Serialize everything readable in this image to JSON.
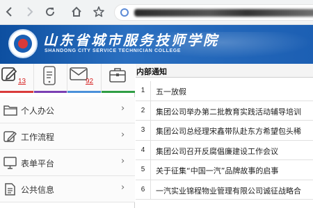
{
  "browser": {
    "icons": [
      "back-arrow-icon",
      "forward-arrow-icon",
      "reload-icon",
      "home-icon",
      "bookmark-star-icon",
      "site-info-icon"
    ]
  },
  "banner": {
    "school_name": "山东省城市服务技师学院",
    "school_name_en": "SHANDONG CITY SERVICE TECHNICIAN COLLEGE"
  },
  "quick_icons": [
    {
      "icon": "edit-icon",
      "count": "13",
      "bar_color": "#d93a3a"
    },
    {
      "icon": "phone-document-icon",
      "count": "",
      "bar_color": "#7b3fb3"
    },
    {
      "icon": "mail-icon",
      "count": "92",
      "bar_color": "#4a90d9"
    },
    {
      "icon": "briefcase-icon",
      "count": "",
      "bar_color": "#2f9e44"
    }
  ],
  "menu": [
    {
      "label": "个人办公",
      "icon": "folder-icon"
    },
    {
      "label": "工作流程",
      "icon": "edit-icon"
    },
    {
      "label": "表单平台",
      "icon": "monitor-icon"
    },
    {
      "label": "公共信息",
      "icon": "document-icon"
    }
  ],
  "notices": {
    "header": "内部通知",
    "items": [
      {
        "num": "1",
        "title": "五一放假"
      },
      {
        "num": "2",
        "title": "集团公司举办第二批教育实践活动辅导培训"
      },
      {
        "num": "3",
        "title": "集团公司总经理宋鑫带队赴东方希望包头稀"
      },
      {
        "num": "4",
        "title": "集团公司召开反腐倡廉建设工作会议"
      },
      {
        "num": "5",
        "title": "关于征集“中国一汽”品牌故事的启事"
      },
      {
        "num": "6",
        "title": "一汽实业锦程物业管理有限公司诚征战略合"
      }
    ]
  }
}
